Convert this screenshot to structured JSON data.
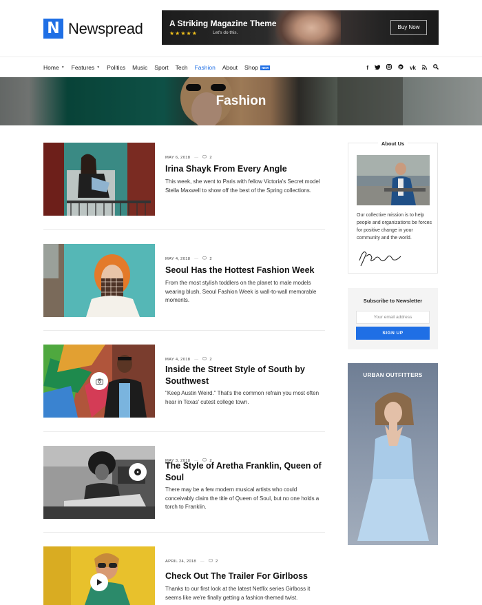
{
  "site": {
    "logo_letter": "N",
    "name": "Newspread"
  },
  "banner": {
    "title": "A Striking Magazine Theme",
    "stars": "★★★★★",
    "subtitle": "Let's do this.",
    "button": "Buy Now"
  },
  "nav": {
    "items": [
      {
        "label": "Home",
        "dropdown": true
      },
      {
        "label": "Features",
        "dropdown": true
      },
      {
        "label": "Politics"
      },
      {
        "label": "Music"
      },
      {
        "label": "Sport"
      },
      {
        "label": "Tech"
      },
      {
        "label": "Fashion",
        "active": true
      },
      {
        "label": "About"
      },
      {
        "label": "Shop",
        "badge": "NEW"
      }
    ],
    "social": [
      "f",
      "t",
      "ig",
      "p",
      "vk",
      "rss",
      "search"
    ]
  },
  "hero": {
    "title": "Fashion"
  },
  "articles": [
    {
      "date": "MAY 6, 2018",
      "comments": "2",
      "title": "Irina Shayk From Every Angle",
      "excerpt": "This week, she went to Paris with fellow Victoria's Secret model Stella Maxwell to show off the best of the Spring collections."
    },
    {
      "date": "MAY 4, 2018",
      "comments": "2",
      "title": "Seoul Has the Hottest Fashion Week",
      "excerpt": "From the most stylish toddlers on the planet to male models wearing blush, Seoul Fashion Week is wall-to-wall memorable moments."
    },
    {
      "date": "MAY 4, 2018",
      "comments": "2",
      "title": "Inside the Street Style of South by Southwest",
      "excerpt": "\"Keep Austin Weird.\" That's the common refrain you most often hear in Texas' cutest college town."
    },
    {
      "date": "MAY 3, 2018",
      "comments": "2",
      "title": "The Style of Aretha Franklin, Queen of Soul",
      "excerpt": "There may be a few modern musical artists who could conceivably claim the title of Queen of Soul, but no one holds a torch to Franklin."
    },
    {
      "date": "APRIL 24, 2018",
      "comments": "2",
      "title": "Check Out The Trailer For Girlboss",
      "excerpt": "Thanks to our first look at the latest Netflix series Girlboss it seems like we're finally getting a fashion-themed twist."
    }
  ],
  "sidebar": {
    "about": {
      "title": "About Us",
      "text": "Our collective mission is to help people and organizations be forces for positive change in your community and the world."
    },
    "newsletter": {
      "title": "Subscribe to Newsletter",
      "placeholder": "Your email address",
      "button": "SIGN UP"
    },
    "ad": {
      "title": "URBAN OUTFITTERS"
    }
  },
  "colors": {
    "accent": "#1f6fe5",
    "star": "#f2c21c"
  }
}
